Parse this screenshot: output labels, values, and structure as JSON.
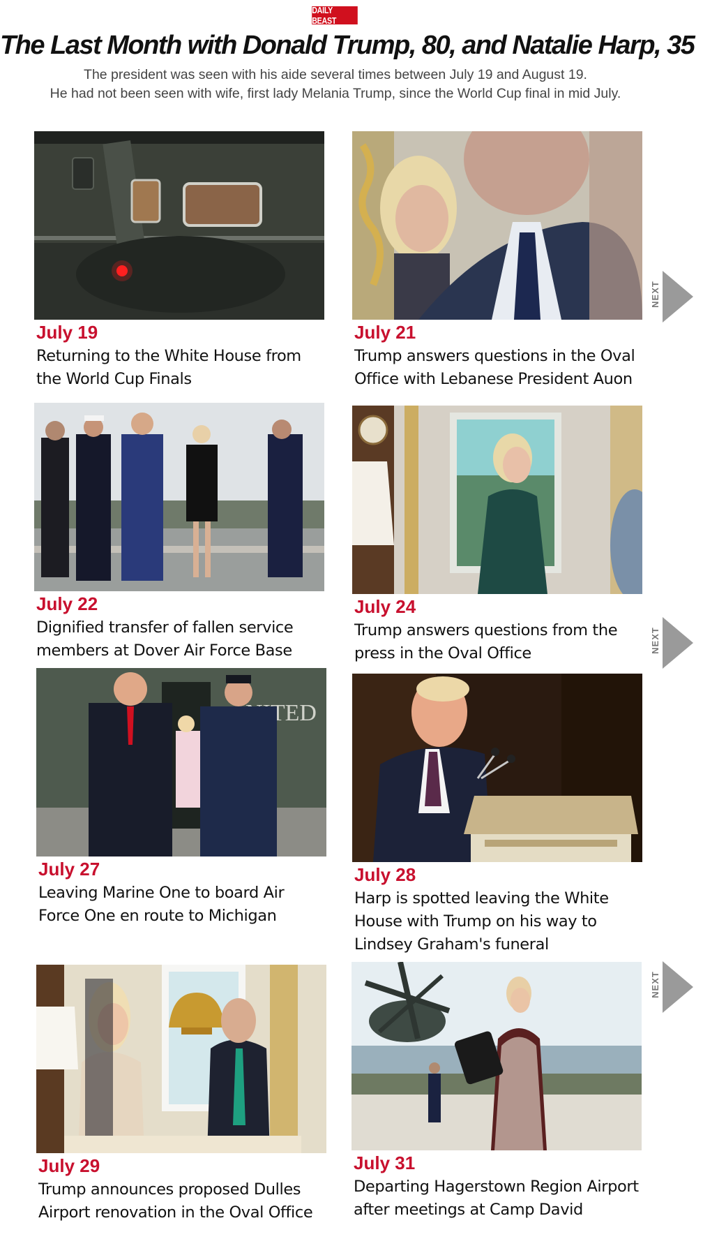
{
  "header": {
    "logo_text": "DAILY BEAST",
    "headline": "The Last Month with Donald Trump, 80, and Natalie Harp, 35",
    "subhead_line1": "The president was seen with his aide several times between July 19 and August 19.",
    "subhead_line2": "He had not been seen with wife, first lady Melania Trump, since the World Cup final in mid July."
  },
  "next_label": "NEXT",
  "entries": [
    {
      "date": "July 19",
      "caption": "Returning to the White House from the World Cup Finals"
    },
    {
      "date": "July 21",
      "caption": "Trump answers questions in the Oval Office with Lebanese President Auon"
    },
    {
      "date": "July 22",
      "caption": "Dignified transfer of fallen service members at Dover Air Force Base"
    },
    {
      "date": "July 24",
      "caption": "Trump answers questions from the press in the Oval Office"
    },
    {
      "date": "July 27",
      "caption": "Leaving Marine One to board Air Force One en route to Michigan"
    },
    {
      "date": "July 28",
      "caption": "Harp is spotted leaving the White House with Trump on his way to Lindsey Graham's funeral"
    },
    {
      "date": "July 29",
      "caption": "Trump announces proposed Dulles Airport renovation in the Oval Office"
    },
    {
      "date": "July 31",
      "caption": "Departing Hagerstown Region Airport after meetings at Camp David"
    }
  ],
  "colors": {
    "brand_red": "#d0101e",
    "date_red": "#c8102e",
    "next_arrow_gray": "#9a9a9a"
  }
}
